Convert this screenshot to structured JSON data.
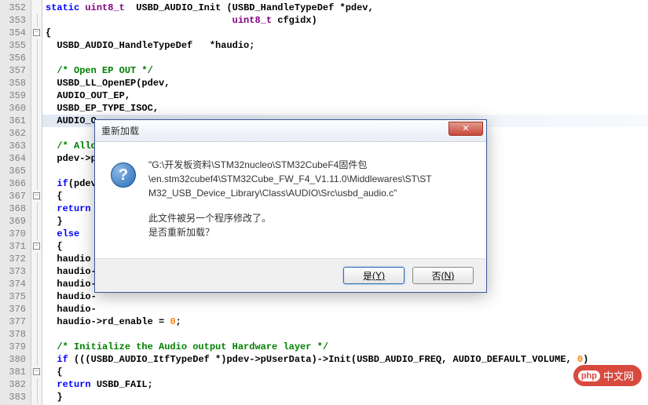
{
  "lines": {
    "start": 352,
    "end": 383
  },
  "code": {
    "l352": {
      "pre": "",
      "parts": [
        {
          "t": "static ",
          "c": "kw"
        },
        {
          "t": "uint8_t",
          "c": "type"
        },
        {
          "t": "  USBD_AUDIO_Init (",
          "c": "normal"
        },
        {
          "t": "USBD_HandleTypeDef",
          "c": "normal"
        },
        {
          "t": " *pdev,",
          "c": "normal"
        }
      ]
    },
    "l353": {
      "pre": "                                 ",
      "parts": [
        {
          "t": "uint8_t",
          "c": "type"
        },
        {
          "t": " cfgidx)",
          "c": "normal"
        }
      ]
    },
    "l354": {
      "pre": "",
      "parts": [
        {
          "t": "{",
          "c": "normal"
        }
      ],
      "fold": "open"
    },
    "l355": {
      "pre": "  ",
      "parts": [
        {
          "t": "USBD_AUDIO_HandleTypeDef   *haudio;",
          "c": "normal"
        }
      ]
    },
    "l356": {
      "pre": "",
      "parts": []
    },
    "l357": {
      "pre": "  ",
      "parts": [
        {
          "t": "/* Open EP OUT */",
          "c": "comment"
        }
      ]
    },
    "l358": {
      "pre": "  ",
      "parts": [
        {
          "t": "USBD_LL_OpenEP(pdev,",
          "c": "normal"
        }
      ]
    },
    "l359": {
      "pre": "  ",
      "parts": [
        {
          "t": "AUDIO_OUT_EP,",
          "c": "normal"
        }
      ]
    },
    "l360": {
      "pre": "  ",
      "parts": [
        {
          "t": "USBD_EP_TYPE_ISOC,",
          "c": "normal"
        }
      ]
    },
    "l361": {
      "pre": "  ",
      "parts": [
        {
          "t": "AUDIO_O",
          "c": "normal"
        }
      ],
      "highlight": true
    },
    "l362": {
      "pre": "",
      "parts": []
    },
    "l363": {
      "pre": "  ",
      "parts": [
        {
          "t": "/* Allo",
          "c": "comment"
        }
      ]
    },
    "l364": {
      "pre": "  ",
      "parts": [
        {
          "t": "pdev->p",
          "c": "normal"
        }
      ]
    },
    "l365": {
      "pre": "",
      "parts": []
    },
    "l366": {
      "pre": "  ",
      "parts": [
        {
          "t": "if",
          "c": "kw"
        },
        {
          "t": "(pdev",
          "c": "normal"
        }
      ]
    },
    "l367": {
      "pre": "  ",
      "parts": [
        {
          "t": "{",
          "c": "normal"
        }
      ],
      "fold": "open"
    },
    "l368": {
      "pre": "  ",
      "parts": [
        {
          "t": "return",
          "c": "kw"
        }
      ]
    },
    "l369": {
      "pre": "  ",
      "parts": [
        {
          "t": "}",
          "c": "normal"
        }
      ]
    },
    "l370": {
      "pre": "  ",
      "parts": [
        {
          "t": "else",
          "c": "kw"
        }
      ]
    },
    "l371": {
      "pre": "  ",
      "parts": [
        {
          "t": "{",
          "c": "normal"
        }
      ],
      "fold": "open"
    },
    "l372": {
      "pre": "  ",
      "parts": [
        {
          "t": "haudio",
          "c": "normal"
        }
      ]
    },
    "l373": {
      "pre": "  ",
      "parts": [
        {
          "t": "haudio-",
          "c": "normal"
        }
      ]
    },
    "l374": {
      "pre": "  ",
      "parts": [
        {
          "t": "haudio-",
          "c": "normal"
        }
      ]
    },
    "l375": {
      "pre": "  ",
      "parts": [
        {
          "t": "haudio-",
          "c": "normal"
        }
      ]
    },
    "l376": {
      "pre": "  ",
      "parts": [
        {
          "t": "haudio-",
          "c": "normal"
        }
      ]
    },
    "l377": {
      "pre": "  ",
      "parts": [
        {
          "t": "haudio->rd_enable = ",
          "c": "normal"
        },
        {
          "t": "0",
          "c": "num"
        },
        {
          "t": ";",
          "c": "normal"
        }
      ]
    },
    "l378": {
      "pre": "",
      "parts": []
    },
    "l379": {
      "pre": "  ",
      "parts": [
        {
          "t": "/* Initialize the Audio output Hardware layer */",
          "c": "comment"
        }
      ]
    },
    "l380": {
      "pre": "  ",
      "parts": [
        {
          "t": "if",
          "c": "kw"
        },
        {
          "t": " (((",
          "c": "normal"
        },
        {
          "t": "USBD_AUDIO_ItfTypeDef",
          "c": "normal"
        },
        {
          "t": " *)pdev->pUserData)->Init(USBD_AUDIO_FREQ, AUDIO_DEFAULT_VOLUME, ",
          "c": "normal"
        },
        {
          "t": "0",
          "c": "num"
        },
        {
          "t": ")",
          "c": "normal"
        }
      ]
    },
    "l381": {
      "pre": "  ",
      "parts": [
        {
          "t": "{",
          "c": "normal"
        }
      ],
      "fold": "open"
    },
    "l382": {
      "pre": "  ",
      "parts": [
        {
          "t": "return",
          "c": "kw"
        },
        {
          "t": " USBD_FAIL;",
          "c": "normal"
        }
      ]
    },
    "l383": {
      "pre": "  ",
      "parts": [
        {
          "t": "}",
          "c": "normal"
        }
      ]
    }
  },
  "dialog": {
    "title": "重新加载",
    "path_line1": "\"G:\\开发板资料\\STM32nucleo\\STM32CubeF4固件包",
    "path_line2": "\\en.stm32cubef4\\STM32Cube_FW_F4_V1.11.0\\Middlewares\\ST\\ST",
    "path_line3": "M32_USB_Device_Library\\Class\\AUDIO\\Src\\usbd_audio.c\"",
    "msg_line1": "此文件被另一个程序修改了。",
    "msg_line2": "是否重新加载？",
    "yes_label": "是",
    "yes_accel": "(Y)",
    "no_label": "否",
    "no_accel": "(N)",
    "close_glyph": "✕",
    "icon_glyph": "?"
  },
  "logo": {
    "php": "php",
    "text": "中文网"
  }
}
